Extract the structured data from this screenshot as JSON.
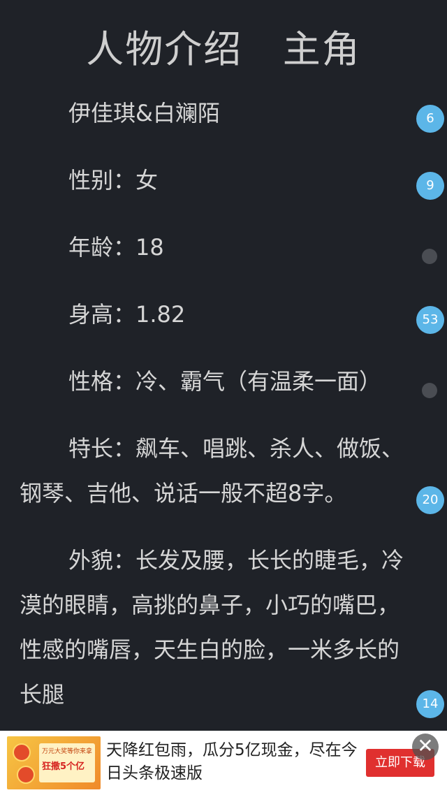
{
  "title": "人物介绍   主角",
  "paragraphs": [
    {
      "text": "伊佳琪&白斓陌",
      "comments": "6"
    },
    {
      "text": "性别：女",
      "comments": "9"
    },
    {
      "text": "年龄：18",
      "comments": ""
    },
    {
      "text": "身高：1.82",
      "comments": "53"
    },
    {
      "text": "性格：冷、霸气（有温柔一面）",
      "comments": ""
    },
    {
      "text": "特长：飙车、唱跳、杀人、做饭、钢琴、吉他、说话一般不超8字。",
      "comments": "20"
    },
    {
      "text": "外貌：长发及腰，长长的睫毛，冷漠的眼睛，高挑的鼻子，小巧的嘴巴，性感的嘴唇，天生白的脸，一米多长的长腿",
      "comments": "14"
    }
  ],
  "ad": {
    "thumb_top": "万元大奖等你来拿",
    "thumb_text": "狂撒5个亿",
    "text": "天降红包雨，瓜分5亿现金，尽在今日头条极速版",
    "button_label": "立即下载",
    "close_icon": "close-icon"
  },
  "colors": {
    "background": "#1f2228",
    "badge": "#5cb6e8",
    "ad_button": "#e0302f"
  }
}
